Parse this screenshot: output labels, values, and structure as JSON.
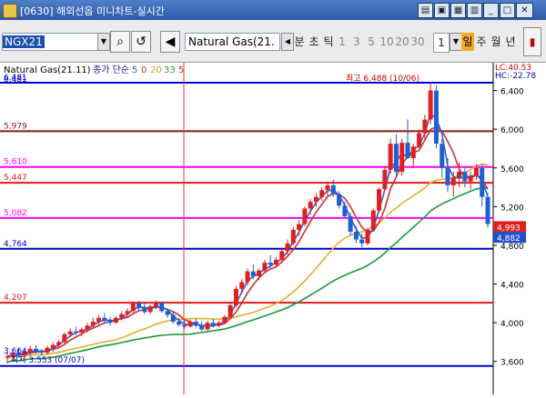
{
  "window": {
    "title": "[0630] 해외선옵 미니차트-실시간"
  },
  "toolbar": {
    "symbol": "NGX21",
    "instrument_name": "Natural Gas(21.",
    "tab_min": "분",
    "tab_sec": "초",
    "tab_tick": "틱",
    "intervals": [
      "1",
      "3",
      "5",
      "10",
      "20",
      "30"
    ],
    "count_value": "1",
    "tab_day": "일",
    "tab_week": "주",
    "tab_month": "월",
    "tab_year": "년",
    "icons": [
      "search-icon",
      "replay-icon",
      "speaker-icon",
      "scroll-left-icon",
      "candle-icon"
    ]
  },
  "chart_data": {
    "type": "candlestick",
    "legend": {
      "instrument": "Natural Gas(21.11)",
      "ma_label": "종가 단순",
      "ma_periods": [
        "5",
        "0",
        "20",
        "33",
        "5"
      ]
    },
    "y_range": [
      3400,
      6650
    ],
    "y_ticks": [
      "6,400",
      "6,000",
      "5,600",
      "5,200",
      "4,800",
      "4,400",
      "4,000",
      "3,600"
    ],
    "top_label_left": "6.481",
    "lc_label": "LC:40.53",
    "hc_label": "HC:-22.78",
    "high_label": "최고 6.488 (10/06)",
    "low_label": "최저 3.553 (07/07)",
    "bottom_left_label": "3.664",
    "current_price_label": "4,993",
    "secondary_price_label": "4,882",
    "horizontal_lines": [
      {
        "value": 6481,
        "label": "6.481",
        "color": "#0000cc"
      },
      {
        "value": 5979,
        "label": "5,979",
        "color": "#8b1a1a"
      },
      {
        "value": 5610,
        "label": "5,610",
        "color": "#ff00ff"
      },
      {
        "value": 5447,
        "label": "5,447",
        "color": "#e01a1a"
      },
      {
        "value": 5082,
        "label": "5,082",
        "color": "#ff00ff"
      },
      {
        "value": 4764,
        "label": "4,764",
        "color": "#0000cc"
      },
      {
        "value": 4207,
        "label": "4,207",
        "color": "#e01a1a"
      },
      {
        "value": 3553,
        "label": "",
        "color": "#0000cc"
      }
    ],
    "ohlc": [
      [
        3640,
        3700,
        3580,
        3650
      ],
      [
        3650,
        3720,
        3620,
        3690
      ],
      [
        3690,
        3740,
        3640,
        3660
      ],
      [
        3660,
        3720,
        3640,
        3700
      ],
      [
        3700,
        3760,
        3660,
        3730
      ],
      [
        3730,
        3770,
        3680,
        3700
      ],
      [
        3700,
        3730,
        3660,
        3690
      ],
      [
        3690,
        3760,
        3670,
        3740
      ],
      [
        3740,
        3800,
        3700,
        3770
      ],
      [
        3770,
        3820,
        3740,
        3800
      ],
      [
        3800,
        3900,
        3780,
        3880
      ],
      [
        3880,
        3940,
        3850,
        3910
      ],
      [
        3910,
        3960,
        3870,
        3900
      ],
      [
        3900,
        3950,
        3860,
        3930
      ],
      [
        3930,
        4000,
        3900,
        3970
      ],
      [
        3970,
        4050,
        3940,
        4010
      ],
      [
        4010,
        4080,
        3980,
        4050
      ],
      [
        4050,
        4100,
        3990,
        4020
      ],
      [
        4020,
        4060,
        3970,
        4000
      ],
      [
        4000,
        4070,
        3990,
        4050
      ],
      [
        4050,
        4120,
        4020,
        4090
      ],
      [
        4090,
        4150,
        4060,
        4120
      ],
      [
        4120,
        4220,
        4100,
        4200
      ],
      [
        4200,
        4230,
        4130,
        4160
      ],
      [
        4160,
        4200,
        4090,
        4110
      ],
      [
        4110,
        4190,
        4090,
        4170
      ],
      [
        4170,
        4230,
        4140,
        4200
      ],
      [
        4200,
        4220,
        4100,
        4120
      ],
      [
        4120,
        4150,
        4050,
        4080
      ],
      [
        4080,
        4120,
        3990,
        4010
      ],
      [
        4010,
        4050,
        3960,
        3980
      ],
      [
        3980,
        4020,
        3940,
        3960
      ],
      [
        3960,
        4030,
        3950,
        4010
      ],
      [
        4010,
        4040,
        3950,
        3970
      ],
      [
        3970,
        4010,
        3910,
        3930
      ],
      [
        3930,
        4020,
        3920,
        4000
      ],
      [
        4000,
        4040,
        3950,
        3970
      ],
      [
        3970,
        4020,
        3950,
        4000
      ],
      [
        4000,
        4080,
        3990,
        4060
      ],
      [
        4060,
        4200,
        4050,
        4180
      ],
      [
        4180,
        4380,
        4160,
        4350
      ],
      [
        4350,
        4450,
        4300,
        4420
      ],
      [
        4420,
        4560,
        4380,
        4530
      ],
      [
        4530,
        4600,
        4450,
        4480
      ],
      [
        4480,
        4560,
        4440,
        4540
      ],
      [
        4540,
        4650,
        4520,
        4620
      ],
      [
        4620,
        4700,
        4560,
        4600
      ],
      [
        4600,
        4680,
        4570,
        4650
      ],
      [
        4650,
        4760,
        4630,
        4740
      ],
      [
        4740,
        4860,
        4700,
        4820
      ],
      [
        4820,
        4990,
        4800,
        4960
      ],
      [
        4960,
        5060,
        4900,
        5020
      ],
      [
        5020,
        5200,
        5000,
        5180
      ],
      [
        5180,
        5280,
        5120,
        5250
      ],
      [
        5250,
        5340,
        5200,
        5300
      ],
      [
        5300,
        5400,
        5260,
        5370
      ],
      [
        5370,
        5460,
        5300,
        5420
      ],
      [
        5420,
        5480,
        5300,
        5330
      ],
      [
        5330,
        5360,
        5180,
        5210
      ],
      [
        5210,
        5250,
        5080,
        5100
      ],
      [
        5100,
        5140,
        4900,
        4940
      ],
      [
        4940,
        5000,
        4820,
        4860
      ],
      [
        4860,
        4920,
        4780,
        4820
      ],
      [
        4820,
        4980,
        4800,
        4960
      ],
      [
        4960,
        5180,
        4940,
        5160
      ],
      [
        5160,
        5400,
        5140,
        5380
      ],
      [
        5380,
        5620,
        5360,
        5580
      ],
      [
        5580,
        5900,
        5540,
        5850
      ],
      [
        5850,
        5950,
        5500,
        5560
      ],
      [
        5560,
        5900,
        5520,
        5860
      ],
      [
        5860,
        6100,
        5800,
        5700
      ],
      [
        5700,
        5850,
        5600,
        5820
      ],
      [
        5820,
        6000,
        5800,
        5960
      ],
      [
        5960,
        6150,
        5900,
        6100
      ],
      [
        6100,
        6488,
        6050,
        6400
      ],
      [
        6400,
        6450,
        5800,
        5850
      ],
      [
        5850,
        5900,
        5500,
        5600
      ],
      [
        5600,
        5700,
        5350,
        5420
      ],
      [
        5420,
        5560,
        5300,
        5500
      ],
      [
        5500,
        5660,
        5400,
        5560
      ],
      [
        5560,
        5600,
        5400,
        5460
      ],
      [
        5460,
        5560,
        5380,
        5520
      ],
      [
        5520,
        5640,
        5480,
        5600
      ],
      [
        5600,
        5640,
        5200,
        5300
      ],
      [
        5300,
        5340,
        4980,
        5020
      ]
    ]
  }
}
